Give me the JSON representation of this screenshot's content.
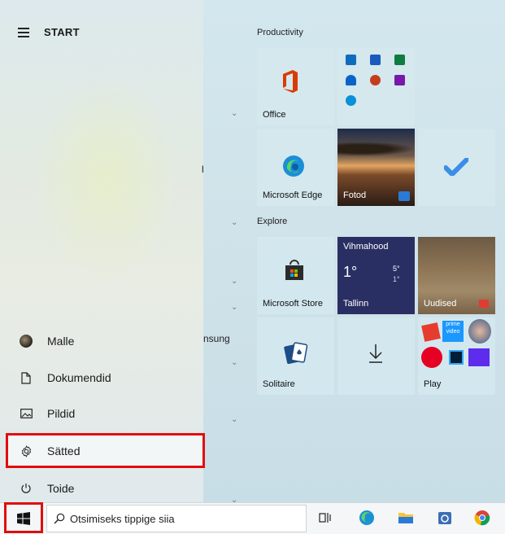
{
  "start": {
    "title": "START"
  },
  "rail": {
    "items": [
      {
        "label": "Malle",
        "icon": "user-avatar"
      },
      {
        "label": "Dokumendid",
        "icon": "document-icon"
      },
      {
        "label": "Pildid",
        "icon": "pictures-icon"
      },
      {
        "label": "Sätted",
        "icon": "gear-icon"
      },
      {
        "label": "Toide",
        "icon": "power-icon"
      }
    ]
  },
  "applist_fragments": {
    "truncated_1": "l",
    "truncated_2": "nsung"
  },
  "groups": {
    "productivity": "Productivity",
    "explore": "Explore"
  },
  "tiles": {
    "office": "Office",
    "edge": "Microsoft Edge",
    "photos": "Fotod",
    "store": "Microsoft Store",
    "weather": {
      "title": "Vihmahood",
      "temp": "1°",
      "high": "5°",
      "low": "1°",
      "city": "Tallinn"
    },
    "news": "Uudised",
    "solitaire": "Solitaire",
    "play": "Play",
    "mini_prime": "prime video"
  },
  "taskbar": {
    "search_placeholder": "Otsimiseks tippige siia"
  },
  "colors": {
    "highlight": "#e10d0d",
    "edge_blue": "#1b8fd6",
    "office_red": "#d83b01",
    "weather_bg": "#2a2f63",
    "todo_blue": "#3b8ee8"
  }
}
